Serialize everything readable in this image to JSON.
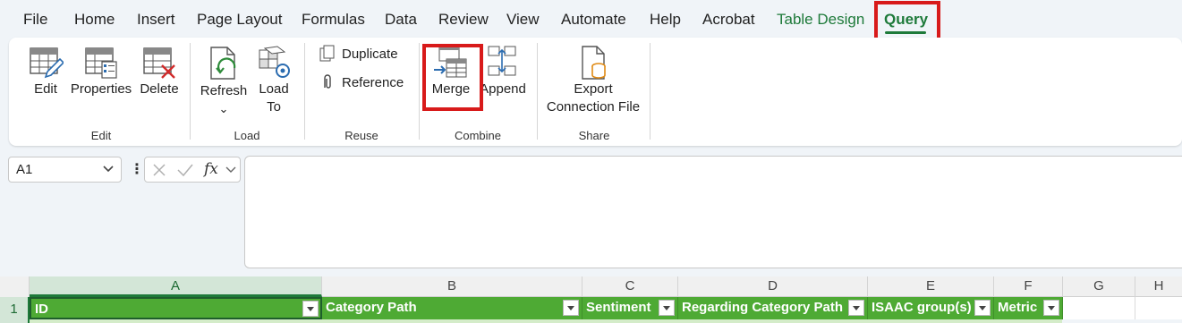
{
  "menu": {
    "tabs": [
      "File",
      "Home",
      "Insert",
      "Page Layout",
      "Formulas",
      "Data",
      "Review",
      "View",
      "Automate",
      "Help",
      "Acrobat",
      "Table Design",
      "Query"
    ]
  },
  "ribbon": {
    "groups": {
      "edit": {
        "label": "Edit",
        "buttons": [
          "Edit",
          "Properties",
          "Delete"
        ]
      },
      "load": {
        "label": "Load",
        "refresh": "Refresh",
        "refresh_chevron": "⌄",
        "load_to_line1": "Load",
        "load_to_line2": "To"
      },
      "reuse": {
        "label": "Reuse",
        "duplicate": "Duplicate",
        "reference": "Reference"
      },
      "combine": {
        "label": "Combine",
        "merge": "Merge",
        "append": "Append"
      },
      "share": {
        "label": "Share",
        "export_line1": "Export",
        "export_line2": "Connection File"
      }
    }
  },
  "formula_bar": {
    "name_box": "A1",
    "fx": "fx"
  },
  "grid": {
    "columns": [
      "A",
      "B",
      "C",
      "D",
      "E",
      "F",
      "G",
      "H"
    ],
    "row_number": "1",
    "headers": [
      "ID",
      "Category Path",
      "Sentiment",
      "Regarding Category Path",
      "ISAAC group(s)",
      "Metric"
    ]
  },
  "colors": {
    "accent_green": "#1e7a3a",
    "table_header_green": "#4eaa34",
    "highlight_red": "#d81a1a"
  }
}
